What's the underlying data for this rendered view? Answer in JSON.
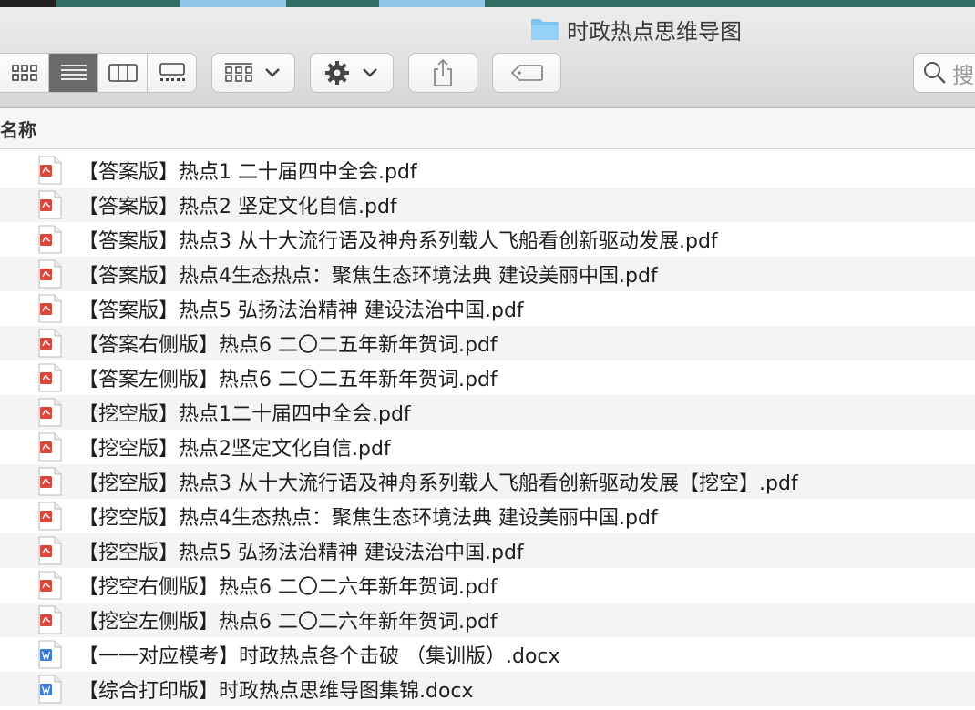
{
  "window": {
    "title": "时政热点思维导图"
  },
  "search": {
    "placeholder": "搜"
  },
  "list": {
    "column_name": "名称",
    "files": [
      {
        "name": "【答案版】热点1 二十届四中全会.pdf",
        "type": "pdf"
      },
      {
        "name": "【答案版】热点2 坚定文化自信.pdf",
        "type": "pdf"
      },
      {
        "name": "【答案版】热点3 从十大流行语及神舟系列载人飞船看创新驱动发展.pdf",
        "type": "pdf"
      },
      {
        "name": "【答案版】热点4生态热点：聚焦生态环境法典 建设美丽中国.pdf",
        "type": "pdf"
      },
      {
        "name": "【答案版】热点5 弘扬法治精神 建设法治中国.pdf",
        "type": "pdf"
      },
      {
        "name": "【答案右侧版】热点6 二〇二五年新年贺词.pdf",
        "type": "pdf"
      },
      {
        "name": "【答案左侧版】热点6 二〇二五年新年贺词.pdf",
        "type": "pdf"
      },
      {
        "name": "【挖空版】热点1二十届四中全会.pdf",
        "type": "pdf"
      },
      {
        "name": "【挖空版】热点2坚定文化自信.pdf",
        "type": "pdf"
      },
      {
        "name": "【挖空版】热点3 从十大流行语及神舟系列载人飞船看创新驱动发展【挖空】.pdf",
        "type": "pdf"
      },
      {
        "name": "【挖空版】热点4生态热点：聚焦生态环境法典 建设美丽中国.pdf",
        "type": "pdf"
      },
      {
        "name": "【挖空版】热点5 弘扬法治精神 建设法治中国.pdf",
        "type": "pdf"
      },
      {
        "name": "【挖空右侧版】热点6 二〇二六年新年贺词.pdf",
        "type": "pdf"
      },
      {
        "name": "【挖空左侧版】热点6 二〇二六年新年贺词.pdf",
        "type": "pdf"
      },
      {
        "name": "【一一对应模考】时政热点各个击破 （集训版）.docx",
        "type": "docx"
      },
      {
        "name": "【综合打印版】时政热点思维导图集锦.docx",
        "type": "docx"
      }
    ]
  },
  "colors": {
    "pdf_accent": "#d9473a",
    "docx_accent": "#3b7ddb",
    "folder": "#7cc3ef",
    "active_view": "#6b6b6b"
  }
}
